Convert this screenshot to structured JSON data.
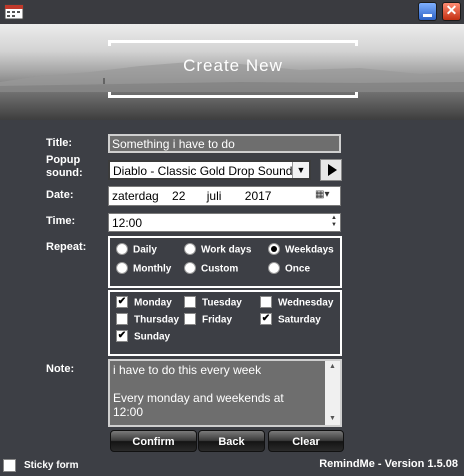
{
  "window": {
    "min_icon": "minimize-icon",
    "close_icon": "close-icon",
    "close_glyph": "✕"
  },
  "banner": {
    "title": "Create New"
  },
  "form": {
    "title_label": "Title:",
    "title_value": "Something i have to do",
    "sound_label_1": "Popup",
    "sound_label_2": "sound:",
    "sound_value": "Diablo - Classic Gold Drop Sound",
    "date_label": "Date:",
    "date_parts": [
      "zaterdag",
      "22",
      "juli",
      "2017"
    ],
    "time_label": "Time:",
    "time_value": "12:00",
    "repeat_label": "Repeat:",
    "repeat_options": [
      "Daily",
      "Work days",
      "Weekdays",
      "Monthly",
      "Custom",
      "Once"
    ],
    "repeat_selected": "Weekdays",
    "days": [
      {
        "name": "Monday",
        "checked": true
      },
      {
        "name": "Tuesday",
        "checked": false
      },
      {
        "name": "Wednesday",
        "checked": false
      },
      {
        "name": "Thursday",
        "checked": false
      },
      {
        "name": "Friday",
        "checked": false
      },
      {
        "name": "Saturday",
        "checked": true
      },
      {
        "name": "Sunday",
        "checked": true
      }
    ],
    "note_label": "Note:",
    "note_value": "i have to do this every week\n\nEvery monday and weekends at\n12:00"
  },
  "actions": {
    "confirm": "Confirm",
    "back": "Back",
    "clear": "Clear"
  },
  "footer": {
    "sticky_label": "Sticky form",
    "version": "RemindMe - Version 1.5.08"
  }
}
